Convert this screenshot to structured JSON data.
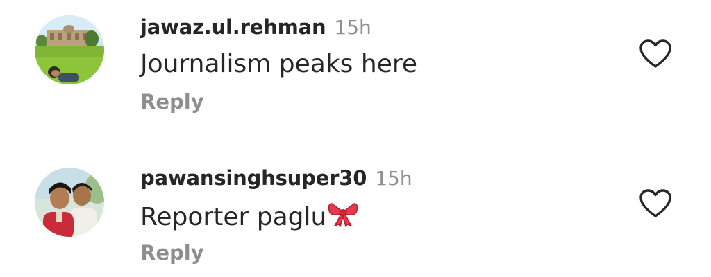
{
  "comments": [
    {
      "username": "jawaz.ul.rehman",
      "time": "15h",
      "text": "Journalism peaks here",
      "reply_label": "Reply",
      "avatar_icon": "avatar-landscape",
      "like_icon": "heart-outline-icon"
    },
    {
      "username": "pawansinghsuper30",
      "time": "15h",
      "text": "Reporter paglu",
      "emoji": "ribbon-bow-emoji",
      "reply_label": "Reply",
      "avatar_icon": "avatar-two-people",
      "like_icon": "heart-outline-icon"
    }
  ],
  "colors": {
    "primary_text": "#262626",
    "secondary_text": "#8e8e8e",
    "background": "#ffffff",
    "bow": "#e8384f"
  }
}
